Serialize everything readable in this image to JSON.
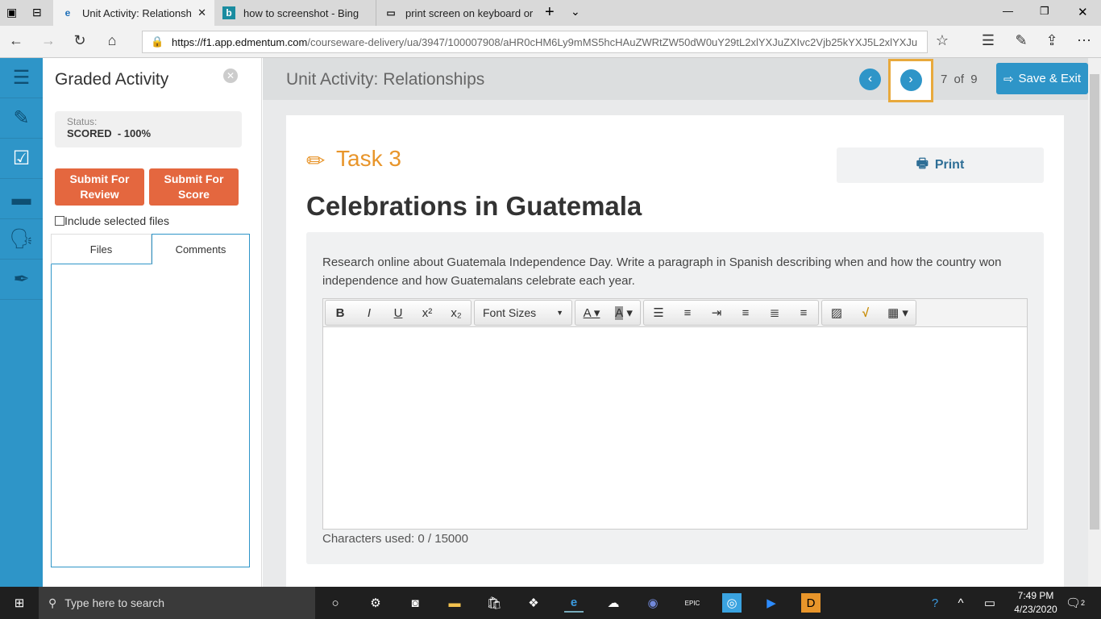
{
  "browser": {
    "tabs": [
      {
        "label": "Unit Activity: Relationsh",
        "active": true
      },
      {
        "label": "how to screenshot - Bing"
      },
      {
        "label": "print screen on keyboard or"
      }
    ],
    "url_domain": "https://f1.app.edmentum.com",
    "url_path": "/courseware-delivery/ua/3947/100007908/aHR0cHM6Ly9mMS5hcHAuZWRtZW50dW0uY29tL2xlYXJuZXIvc2Vjb25kYXJ5L2xlYXJu"
  },
  "panel": {
    "title": "Graded Activity",
    "status_label": "Status:",
    "status_value": "SCORED  - 100%",
    "submit_review": "Submit For Review",
    "submit_score": "Submit For Score",
    "include_files": "Include selected files",
    "tabs": [
      "Files",
      "Comments"
    ],
    "active_tab": "Comments"
  },
  "header": {
    "title": "Unit Activity: Relationships",
    "page_current": "7",
    "page_of": "of",
    "page_total": "9",
    "save_exit": "Save & Exit"
  },
  "content": {
    "task": "Task 3",
    "print": "Print",
    "heading": "Celebrations in Guatemala",
    "prompt": "Research online about Guatemala Independence Day. Write a paragraph in Spanish describing when and how the country won independence and how Guatemalans celebrate each year.",
    "font_sizes": "Font Sizes",
    "chars_used": "Characters used: 0 / 15000"
  },
  "taskbar": {
    "search_placeholder": "Type here to search",
    "time": "7:49 PM",
    "date": "4/23/2020",
    "notifications": "2"
  },
  "colors": {
    "accent": "#2e95c8",
    "orange": "#e4673f",
    "task": "#e8952a"
  }
}
